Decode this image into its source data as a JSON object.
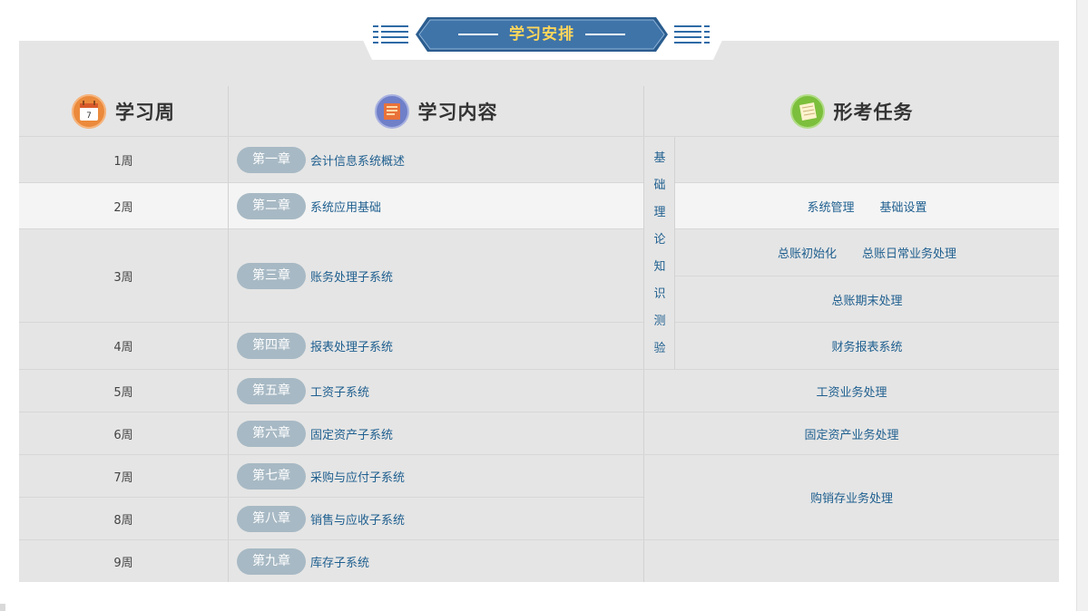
{
  "banner": {
    "title": "学习安排"
  },
  "headers": {
    "week": "学习周",
    "content": "学习内容",
    "tasks": "形考任务"
  },
  "icons": {
    "calendar_day": "7"
  },
  "weeks": [
    "1周",
    "2周",
    "3周",
    "4周",
    "5周",
    "6周",
    "7周",
    "8周",
    "9周"
  ],
  "chapters": [
    {
      "label": "第一章",
      "title": "会计信息系统概述"
    },
    {
      "label": "第二章",
      "title": "系统应用基础"
    },
    {
      "label": "第三章",
      "title": "账务处理子系统"
    },
    {
      "label": "第四章",
      "title": "报表处理子系统"
    },
    {
      "label": "第五章",
      "title": "工资子系统"
    },
    {
      "label": "第六章",
      "title": "固定资产子系统"
    },
    {
      "label": "第七章",
      "title": "采购与应付子系统"
    },
    {
      "label": "第八章",
      "title": "销售与应收子系统"
    },
    {
      "label": "第九章",
      "title": "库存子系统"
    }
  ],
  "basic_section": {
    "chars": [
      "基",
      "础",
      "理",
      "论",
      "知",
      "识",
      "测",
      "验"
    ]
  },
  "tasks": {
    "system_mgmt": "系统管理",
    "basic_setup": "基础设置",
    "gl_init": "总账初始化",
    "gl_daily": "总账日常业务处理",
    "gl_period_end": "总账期末处理",
    "financial_reports": "财务报表系统",
    "payroll": "工资业务处理",
    "fixed_assets": "固定资产业务处理",
    "purchase_sales_inventory": "购销存业务处理"
  },
  "colors": {
    "banner_fill": "#356a9e",
    "banner_text": "#ffd75b",
    "pill_bg": "#a7b9c4",
    "link_text": "#1f5f8f",
    "panel_bg": "#e5e5e5"
  }
}
